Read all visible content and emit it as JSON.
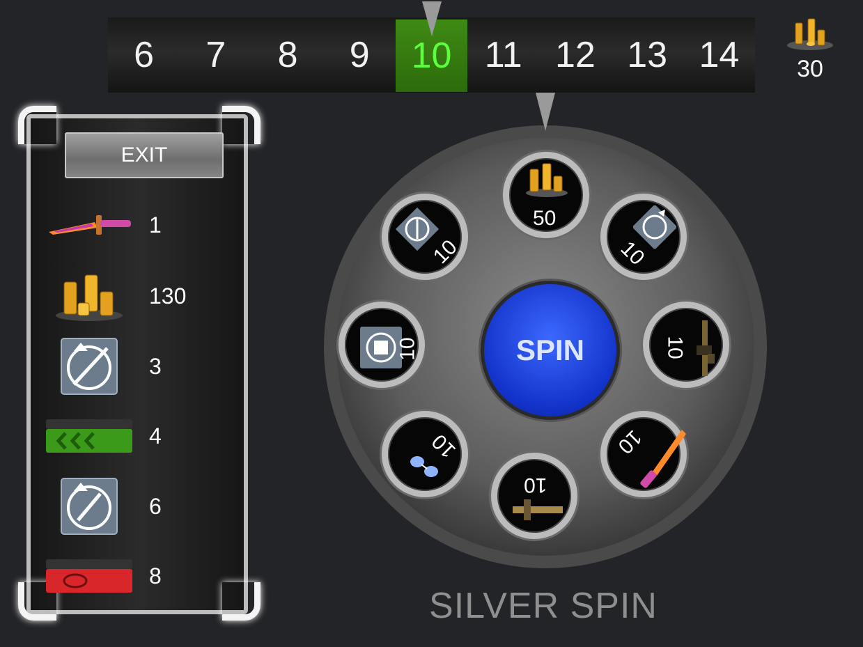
{
  "roulette": {
    "numbers": [
      "6",
      "7",
      "8",
      "9",
      "10",
      "11",
      "12",
      "13",
      "14"
    ],
    "active_index": 4
  },
  "currency": {
    "icon": "gold-coins-icon",
    "amount": "30"
  },
  "panel": {
    "exit_label": "EXIT",
    "items": [
      {
        "name": "knife-skin",
        "count": "1"
      },
      {
        "name": "gold-coins",
        "count": "130"
      },
      {
        "name": "rifle-upgrade-token",
        "count": "3"
      },
      {
        "name": "green-crate",
        "count": "4"
      },
      {
        "name": "knife-upgrade-token",
        "count": "6"
      },
      {
        "name": "red-crate",
        "count": "8"
      }
    ]
  },
  "wheel": {
    "spin_label": "SPIN",
    "title": "SILVER SPIN",
    "slots": [
      {
        "reward": "gold-coins",
        "value": "50"
      },
      {
        "reward": "armor-upgrade-token",
        "value": "10"
      },
      {
        "reward": "assault-rifle",
        "value": "10"
      },
      {
        "reward": "knife-skin",
        "value": "10"
      },
      {
        "reward": "crossbow",
        "value": "10"
      },
      {
        "reward": "sunglasses",
        "value": "10"
      },
      {
        "reward": "ammo-token",
        "value": "10"
      },
      {
        "reward": "knife-upgrade-token",
        "value": "10"
      }
    ]
  },
  "colors": {
    "active_cell": "#3f8a15",
    "active_text": "#5cff3d",
    "spin_button": "#1f45e0"
  }
}
